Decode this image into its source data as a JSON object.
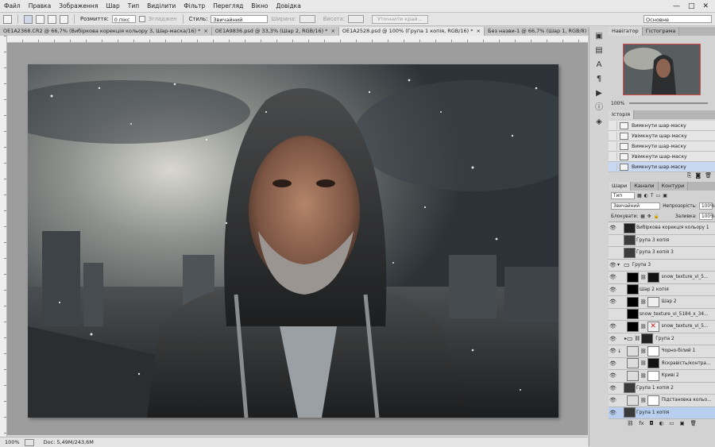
{
  "menu": [
    "Файл",
    "Правка",
    "Зображення",
    "Шар",
    "Тип",
    "Виділити",
    "Фільтр",
    "Перегляд",
    "Вікно",
    "Довідка"
  ],
  "window_controls": [
    "—",
    "□",
    "✕"
  ],
  "options": {
    "feather_label": "Розмиття:",
    "feather_value": "0 пікс",
    "antialias_label": "Згладжен",
    "style_label": "Стиль:",
    "style_value": "Звичайний",
    "width_label": "Ширина:",
    "height_label": "Висота:",
    "refine_button": "Уточнити край...",
    "workspace_value": "Основне"
  },
  "tabs": [
    {
      "label": "OE1A2368.CR2 @ 66,7% (Вибіркова корекція кольору 3, Шар-маска/16) *",
      "active": false
    },
    {
      "label": "OE1A9836.psd @ 33,3% (Шар 2, RGB/16) *",
      "active": false
    },
    {
      "label": "OE1A2528.psd @ 100% (Група 1 копія, RGB/16) *",
      "active": true
    },
    {
      "label": "Без назви-1 @ 66,7% (Шар 1, RGB/8) *",
      "active": false
    }
  ],
  "status": {
    "zoom": "100%",
    "doc": "Doc: 5,49M/243,6M"
  },
  "navigator": {
    "tabs": [
      "Навігатор",
      "Гістограма"
    ],
    "zoom": "100%"
  },
  "history": {
    "title": "Історія",
    "items": [
      "Вимкнути шар-маску",
      "Увімкнути шар-маску",
      "Вимкнути шар-маску",
      "Увімкнути шар-маску",
      "Вимкнути шар-маску"
    ]
  },
  "layers_panel": {
    "tabs": [
      "Шари",
      "Канали",
      "Контури"
    ],
    "filter_label": "Тип",
    "blend_mode": "Звичайний",
    "opacity_label": "Непрозорість:",
    "opacity_value": "100%",
    "lock_label": "Блокувати:",
    "fill_label": "Заливка:",
    "fill_value": "100%",
    "layers": [
      "Вибіркова корекція кольору 1",
      "Група 3 копія",
      "Група 3 копія 3",
      "Група 3",
      "snow_texture_vi_5...",
      "Шар 2 копія",
      "Шар 2",
      "snow_texture_vi_5184_x_34...",
      "snow_texture_vi_5...",
      "Група 2",
      "Чорно-білий 1",
      "Яскравість/контра...",
      "Криві 2",
      "Група 1 копія 2",
      "Підстановка кольо...",
      "Група 1 копія"
    ]
  },
  "colors": {
    "selection": "#b9cfef",
    "accent": "#4a78c0"
  }
}
